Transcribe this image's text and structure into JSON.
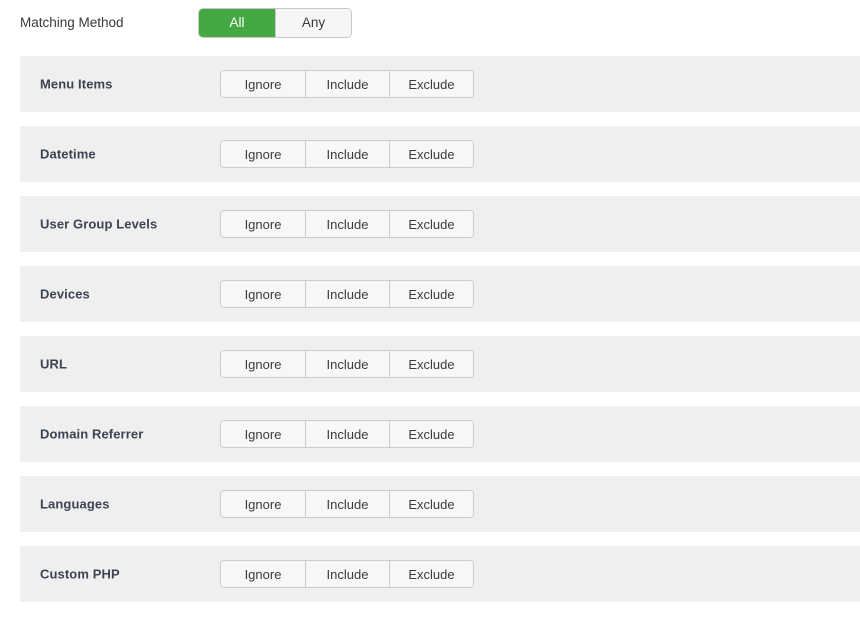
{
  "matching_method": {
    "label": "Matching Method",
    "options": [
      {
        "label": "All",
        "selected": true
      },
      {
        "label": "Any",
        "selected": false
      }
    ],
    "active_color": "#45a943"
  },
  "conditions": {
    "option_labels": [
      "Ignore",
      "Include",
      "Exclude"
    ],
    "rows": [
      {
        "label": "Menu Items"
      },
      {
        "label": "Datetime"
      },
      {
        "label": "User Group Levels"
      },
      {
        "label": "Devices"
      },
      {
        "label": "URL"
      },
      {
        "label": "Domain Referrer"
      },
      {
        "label": "Languages"
      },
      {
        "label": "Custom PHP"
      }
    ]
  },
  "colors": {
    "row_background": "#efefef",
    "page_background": "#ffffff",
    "button_background": "#f7f7f7",
    "button_border": "#cccccc",
    "label_text": "#3c4451"
  }
}
